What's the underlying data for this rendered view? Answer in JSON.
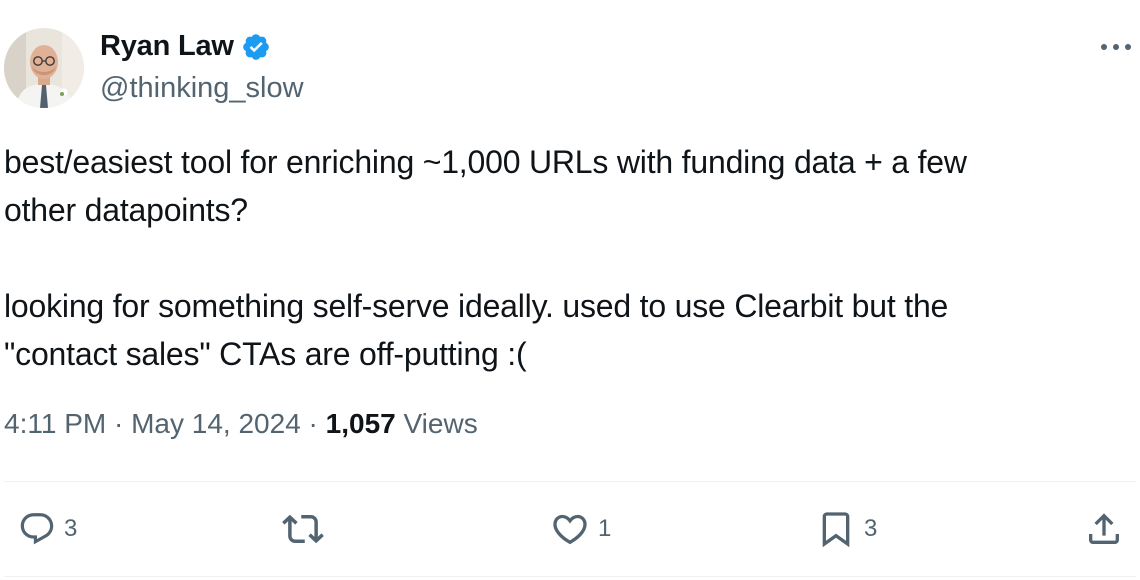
{
  "author": {
    "display_name": "Ryan Law",
    "handle": "@thinking_slow",
    "verified": true,
    "avatar_icon": "person-photo-avatar"
  },
  "tweet": {
    "lines_paragraph_1": [
      "best/easiest tool for enriching ~1,000 URLs with funding data + a few",
      "other datapoints?"
    ],
    "lines_paragraph_2": [
      "looking for something self-serve ideally. used to use Clearbit but the",
      "\"contact sales\" CTAs are off-putting :("
    ]
  },
  "meta": {
    "time": "4:11 PM",
    "separator": " · ",
    "date": "May 14, 2024",
    "views_count": "1,057",
    "views_label": "Views"
  },
  "actions": {
    "replies": {
      "icon": "reply-icon",
      "count": "3"
    },
    "reposts": {
      "icon": "repost-icon",
      "count": ""
    },
    "likes": {
      "icon": "heart-icon",
      "count": "1"
    },
    "bookmarks": {
      "icon": "bookmark-icon",
      "count": "3"
    },
    "share": {
      "icon": "share-icon",
      "count": ""
    }
  },
  "colors": {
    "text_primary": "#0f1419",
    "text_secondary": "#536471",
    "verified_blue": "#1d9bf0",
    "divider": "#eff3f4"
  }
}
